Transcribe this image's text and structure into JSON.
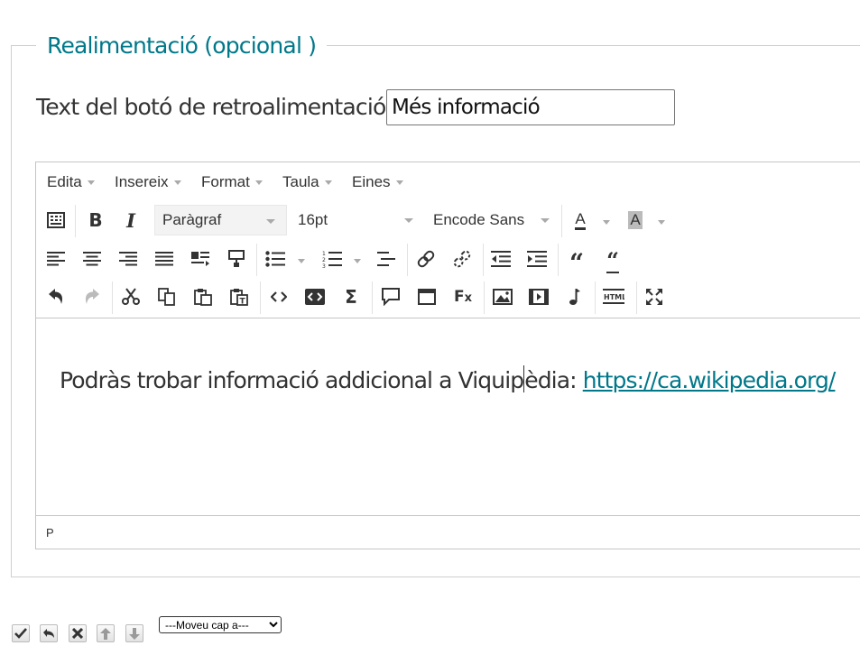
{
  "fieldset": {
    "legend": "Realimentació (opcional )"
  },
  "feedback": {
    "label": "Text del botó de retroalimentació:",
    "value": "Més informació"
  },
  "editor": {
    "menus": [
      "Edita",
      "Insereix",
      "Format",
      "Taula",
      "Eines"
    ],
    "block_format": "Paràgraf",
    "font_size": "16pt",
    "font_family": "Encode Sans",
    "text_color_letter": "A",
    "bg_color_letter": "A",
    "content": {
      "text_before_cursor": "Podràs trobar informació addicional a Viquip",
      "text_after_cursor": "èdia: ",
      "link_text": "https://ca.wikipedia.org/"
    },
    "status_path": "P"
  },
  "bottom": {
    "move_select": "---Moveu cap a---"
  },
  "colors": {
    "accent": "#00788a",
    "text": "#333333",
    "border": "#c5c5c5"
  },
  "icons": [
    "toolbar-toggle-icon",
    "bold-icon",
    "italic-icon",
    "text-color-icon",
    "background-color-icon",
    "align-left-icon",
    "align-center-icon",
    "align-right-icon",
    "align-justify-icon",
    "text-direction-icon",
    "format-painter-icon",
    "bullet-list-icon",
    "numbered-list-icon",
    "indent-list-icon",
    "link-icon",
    "unlink-icon",
    "outdent-icon",
    "indent-icon",
    "blockquote-icon",
    "quote-icon",
    "undo-icon",
    "redo-icon",
    "cut-icon",
    "copy-icon",
    "paste-icon",
    "paste-text-icon",
    "code-icon",
    "code-block-icon",
    "sigma-icon",
    "comment-icon",
    "window-icon",
    "formula-icon",
    "image-icon",
    "video-icon",
    "music-icon",
    "html-icon",
    "fullscreen-icon",
    "check-icon",
    "reply-icon",
    "delete-icon",
    "move-up-icon",
    "move-down-icon"
  ]
}
